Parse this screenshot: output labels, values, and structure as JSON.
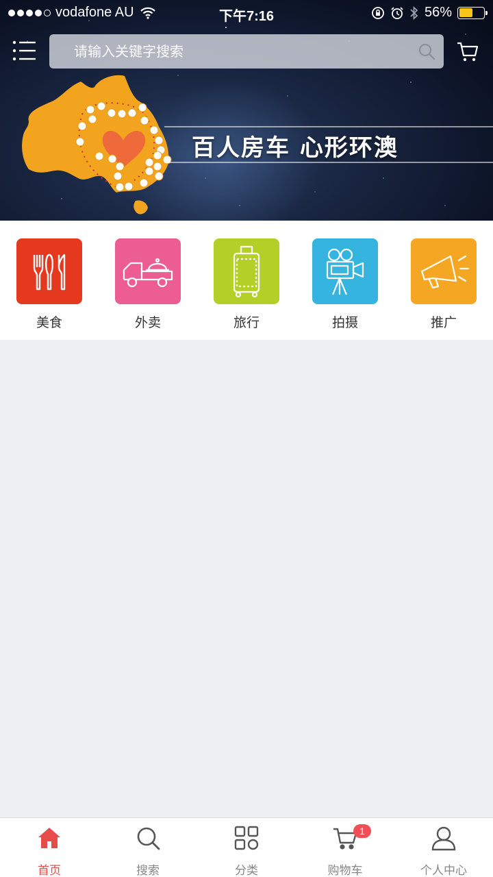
{
  "status_bar": {
    "carrier": "vodafone AU",
    "time": "下午7:16",
    "battery_percent": "56%",
    "battery_level": 0.56,
    "signal_bars": 4,
    "signal_total": 5
  },
  "header": {
    "menu_icon": "list-menu-icon",
    "search_placeholder": "请输入关键字搜索",
    "cart_icon": "cart-icon"
  },
  "banner": {
    "title": "百人房车  心形环澳"
  },
  "categories": [
    {
      "label": "美食",
      "icon": "utensils-icon",
      "color": "#e5391f"
    },
    {
      "label": "外卖",
      "icon": "delivery-truck-icon",
      "color": "#ec5e93"
    },
    {
      "label": "旅行",
      "icon": "luggage-icon",
      "color": "#b5cf29"
    },
    {
      "label": "拍摄",
      "icon": "movie-camera-icon",
      "color": "#35b4e0"
    },
    {
      "label": "推广",
      "icon": "megaphone-icon",
      "color": "#f5a623"
    }
  ],
  "tabbar": {
    "tabs": [
      {
        "label": "首页",
        "icon": "home-icon",
        "active": true
      },
      {
        "label": "搜索",
        "icon": "search-icon",
        "active": false
      },
      {
        "label": "分类",
        "icon": "grid-icon",
        "active": false
      },
      {
        "label": "购物车",
        "icon": "cart-icon",
        "active": false,
        "badge": "1"
      },
      {
        "label": "个人中心",
        "icon": "user-icon",
        "active": false
      }
    ]
  },
  "colors": {
    "accent": "#e74c4c",
    "background": "#eef1f4"
  }
}
